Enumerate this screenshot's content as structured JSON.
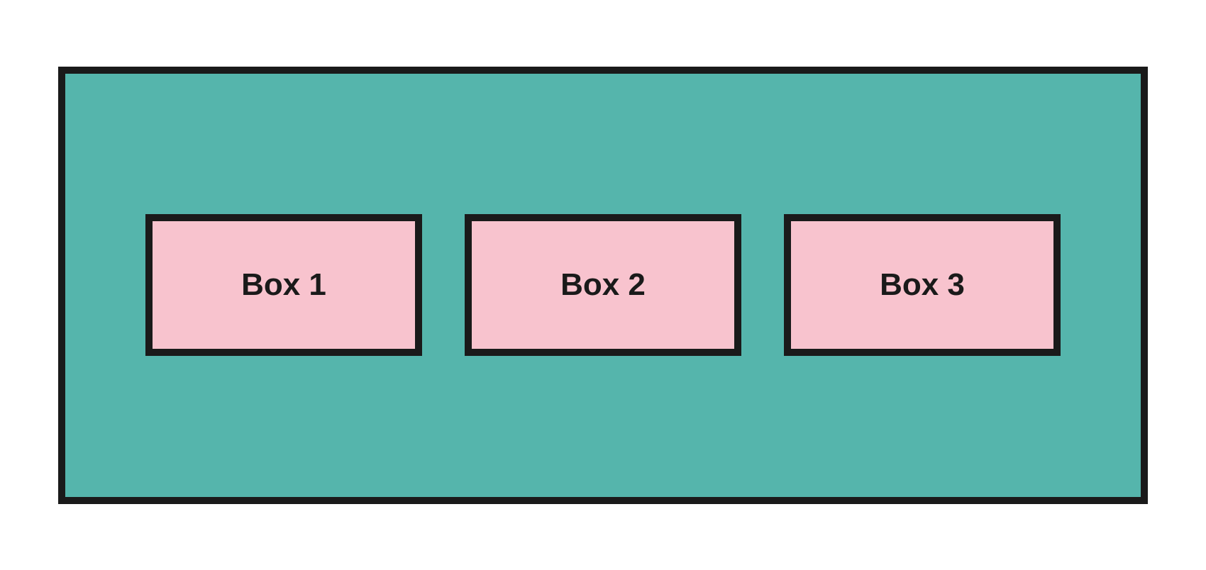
{
  "container": {
    "bg_color": "#55b5ac",
    "border_color": "#1a1a1a"
  },
  "boxes": [
    {
      "label": "Box 1"
    },
    {
      "label": "Box 2"
    },
    {
      "label": "Box 3"
    }
  ],
  "box_style": {
    "bg_color": "#f8c3ce",
    "border_color": "#1a1a1a"
  }
}
